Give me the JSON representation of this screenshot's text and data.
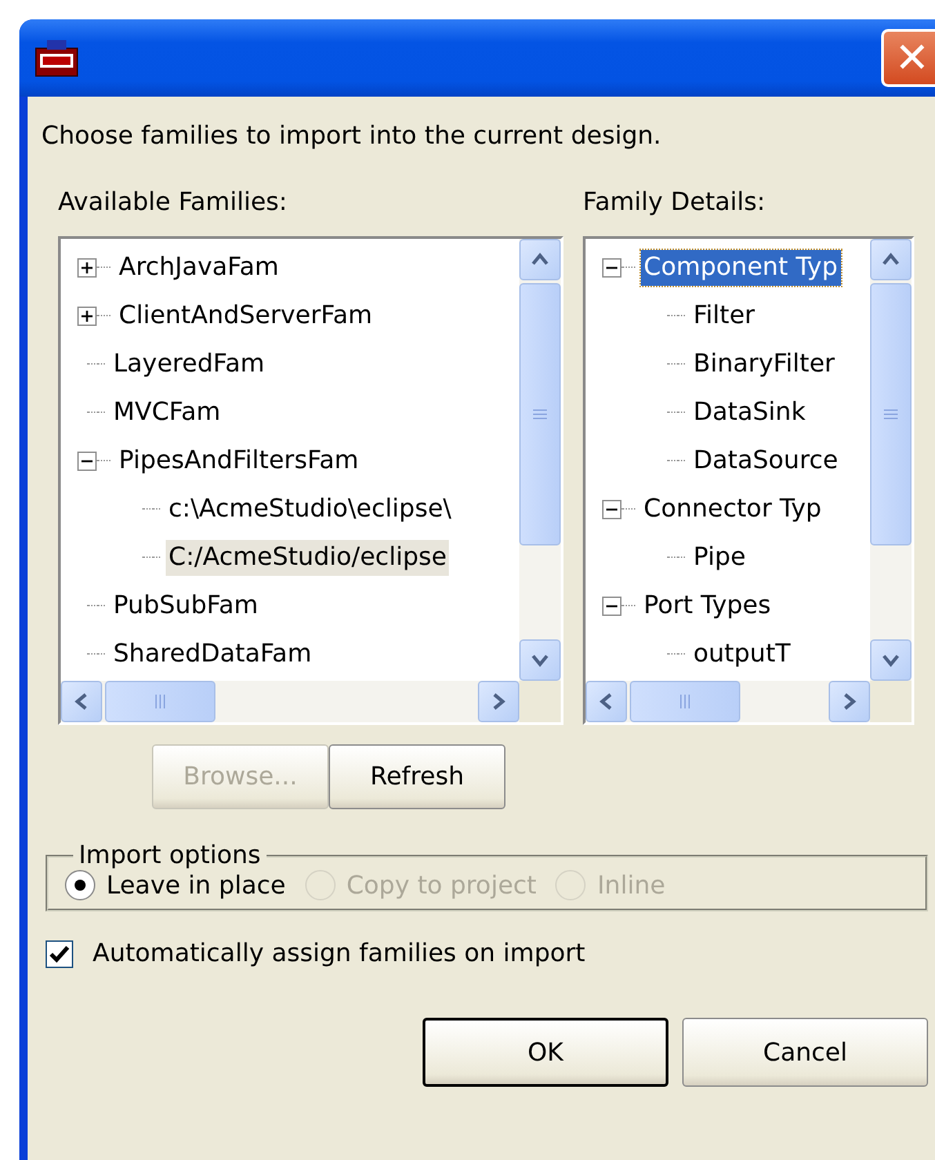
{
  "window": {
    "close_label": "✕"
  },
  "instruction": "Choose families to import into the current design.",
  "available_families": {
    "label": "Available Families:",
    "focused": false,
    "items": [
      {
        "label": "ArchJavaFam",
        "expanded": false,
        "selected": false
      },
      {
        "label": "ClientAndServerFam",
        "expanded": false,
        "selected": false
      },
      {
        "label": "LayeredFam",
        "selected": false
      },
      {
        "label": "MVCFam",
        "selected": false
      },
      {
        "label": "PipesAndFiltersFam",
        "expanded": true,
        "selected": false,
        "children": [
          {
            "label": "c:\\AcmeStudio\\eclipse\\",
            "selected": false
          },
          {
            "label": "C:/AcmeStudio/eclipse",
            "selected": true
          }
        ]
      },
      {
        "label": "PubSubFam",
        "selected": false
      },
      {
        "label": "SharedDataFam",
        "selected": false
      }
    ]
  },
  "family_details": {
    "label": "Family Details:",
    "focused": true,
    "items": [
      {
        "label": "Component Typ",
        "expanded": true,
        "selected": true,
        "children": [
          {
            "label": "Filter",
            "selected": false
          },
          {
            "label": "BinaryFilter",
            "selected": false
          },
          {
            "label": "DataSink",
            "selected": false
          },
          {
            "label": "DataSource",
            "selected": false
          }
        ]
      },
      {
        "label": "Connector Typ",
        "expanded": true,
        "selected": false,
        "children": [
          {
            "label": "Pipe",
            "selected": false
          }
        ]
      },
      {
        "label": "Port Types",
        "expanded": true,
        "selected": false,
        "children": [
          {
            "label": "outputT",
            "selected": false
          }
        ]
      }
    ]
  },
  "tree_buttons": [
    {
      "label": "Browse...",
      "disabled": true
    },
    {
      "label": "Refresh",
      "disabled": false
    }
  ],
  "import_options": {
    "label": "Import options",
    "options": [
      {
        "label": "Leave in place",
        "selected": true,
        "disabled": false
      },
      {
        "label": "Copy to project",
        "selected": false,
        "disabled": true
      },
      {
        "label": "Inline",
        "selected": false,
        "disabled": true
      }
    ]
  },
  "auto_assign": {
    "label": "Automatically assign families on import",
    "checked": true
  },
  "buttons": [
    {
      "label": "OK",
      "default": true
    },
    {
      "label": "Cancel",
      "default": false
    }
  ]
}
